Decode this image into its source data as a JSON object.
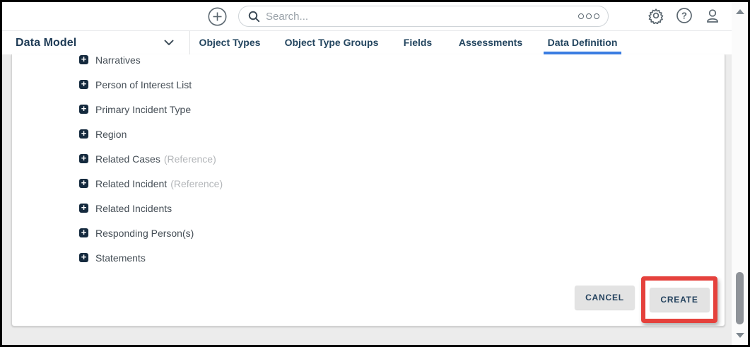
{
  "topbar": {
    "search_placeholder": "Search...",
    "icons": [
      "add-icon",
      "search-icon",
      "more-options-icon",
      "settings-icon",
      "help-icon",
      "profile-icon"
    ]
  },
  "nav": {
    "dropdown_label": "Data Model",
    "tabs": [
      {
        "label": "Object Types",
        "active": false
      },
      {
        "label": "Object Type Groups",
        "active": false
      },
      {
        "label": "Fields",
        "active": false
      },
      {
        "label": "Assessments",
        "active": false
      },
      {
        "label": "Data Definition",
        "active": true
      }
    ]
  },
  "list": {
    "items": [
      {
        "label": "Narratives"
      },
      {
        "label": "Person of Interest List"
      },
      {
        "label": "Primary Incident Type"
      },
      {
        "label": "Region"
      },
      {
        "label": "Related Cases",
        "suffix": "(Reference)"
      },
      {
        "label": "Related Incident",
        "suffix": "(Reference)"
      },
      {
        "label": "Related Incidents"
      },
      {
        "label": "Responding Person(s)"
      },
      {
        "label": "Statements"
      }
    ]
  },
  "actions": {
    "cancel_label": "CANCEL",
    "create_label": "CREATE"
  },
  "colors": {
    "accent_blue": "#3b7de2",
    "annotation_red": "#e5413c",
    "navy_text": "#1d3a55",
    "icon_gray": "#5b6770",
    "page_bg": "#ececec"
  }
}
